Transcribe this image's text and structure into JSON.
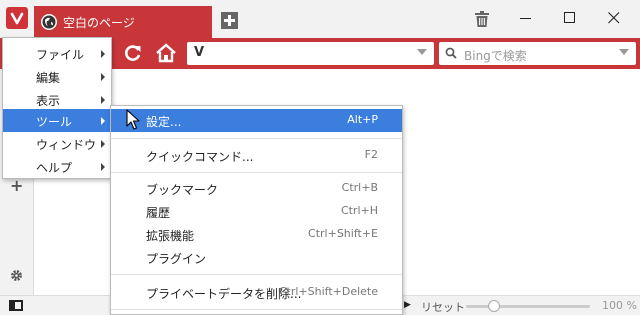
{
  "titlebar": {
    "tab_title": "空白のページ"
  },
  "address": {
    "value": "",
    "logo_text": "V"
  },
  "search": {
    "placeholder": "Bingで検索"
  },
  "main_menu": {
    "items": [
      {
        "label": "ファイル"
      },
      {
        "label": "編集"
      },
      {
        "label": "表示"
      },
      {
        "label": "ツール"
      },
      {
        "label": "ウィンドウ"
      },
      {
        "label": "ヘルプ"
      }
    ],
    "selected": "ツール"
  },
  "tools_menu": {
    "items": [
      {
        "label": "設定...",
        "shortcut": "Alt+P"
      },
      {
        "label": "クイックコマンド...",
        "shortcut": "F2"
      },
      {
        "label": "ブックマーク",
        "shortcut": "Ctrl+B"
      },
      {
        "label": "履歴",
        "shortcut": "Ctrl+H"
      },
      {
        "label": "拡張機能",
        "shortcut": "Ctrl+Shift+E"
      },
      {
        "label": "プラグイン",
        "shortcut": ""
      },
      {
        "label": "プライベートデータを削除...",
        "shortcut": "Ctrl+Shift+Delete"
      }
    ],
    "selected": "設定..."
  },
  "statusbar": {
    "reset_label": "リセット",
    "zoom_label": "100 %",
    "zoom_level": 0.1
  },
  "colors": {
    "accent": "#c8363a",
    "selection": "#3b7ede"
  },
  "icons": [
    "vivaldi-logo-icon",
    "globe-icon",
    "new-tab-icon",
    "trash-icon",
    "minimize-icon",
    "maximize-icon",
    "close-icon",
    "reload-icon",
    "home-icon",
    "search-icon",
    "gear-icon",
    "add-panel-icon",
    "panel-toggle-icon",
    "mouse-cursor-icon"
  ]
}
